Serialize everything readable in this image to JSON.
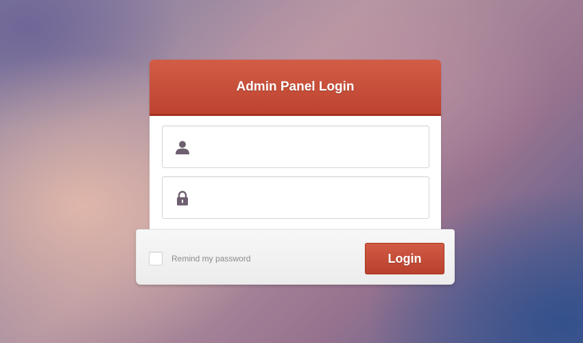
{
  "panel": {
    "title": "Admin Panel Login"
  },
  "form": {
    "username": {
      "value": "",
      "placeholder": "",
      "icon": "user-icon"
    },
    "password": {
      "value": "",
      "placeholder": "",
      "icon": "lock-icon"
    },
    "remember": {
      "label": "Remind my password",
      "checked": false
    },
    "submit_label": "Login"
  },
  "colors": {
    "accent": "#c34b35",
    "accent_dark": "#a3321f",
    "icon": "#6e5f70"
  }
}
